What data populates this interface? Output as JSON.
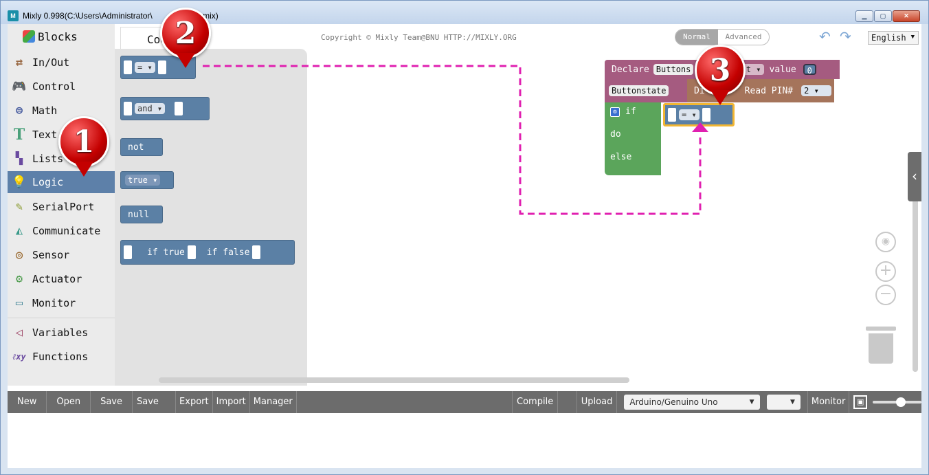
{
  "window": {
    "title": "Mixly 0.998(C:\\Users\\Administrator\\",
    "title_suffix": "sson3.mix)"
  },
  "sidebar": {
    "header": "Blocks",
    "categories": [
      {
        "label": "In/Out",
        "icon": "arrows-icon",
        "color": "#9a6a45"
      },
      {
        "label": "Control",
        "icon": "gamepad-icon",
        "color": "#4a8a4a"
      },
      {
        "label": "Math",
        "icon": "math-icon",
        "color": "#4a5ea0"
      },
      {
        "label": "Text",
        "icon": "text-icon",
        "color": "#4aa07a"
      },
      {
        "label": "Lists",
        "icon": "lists-icon",
        "color": "#6a4aa0"
      },
      {
        "label": "Logic",
        "icon": "bulb-icon",
        "color": "#ffffff"
      },
      {
        "label": "SerialPort",
        "icon": "pen-icon",
        "color": "#8a9a30"
      },
      {
        "label": "Communicate",
        "icon": "signal-icon",
        "color": "#3a9a8a"
      },
      {
        "label": "Sensor",
        "icon": "sensor-icon",
        "color": "#9a6a30"
      },
      {
        "label": "Actuator",
        "icon": "actuator-icon",
        "color": "#4a9a4a"
      },
      {
        "label": "Monitor",
        "icon": "monitor-icon",
        "color": "#4a8a9a"
      },
      {
        "label": "Variables",
        "icon": "variables-icon",
        "color": "#a04a6a"
      },
      {
        "label": "Functions",
        "icon": "functions-icon",
        "color": "#6a4aa0"
      }
    ]
  },
  "topbar": {
    "code_tab": "Cod",
    "copyright": "Copyright © Mixly Team@BNU HTTP://MIXLY.ORG",
    "mode_normal": "Normal",
    "mode_advanced": "Advanced",
    "language": "English"
  },
  "flyout": {
    "compare_op": "=",
    "and_op": "and",
    "not_label": "not",
    "true_label": "true",
    "null_label": "null",
    "ternary_true": "if true",
    "ternary_false": "if false"
  },
  "workspace": {
    "declare_label": "Declare",
    "declare_var": "Buttons",
    "declare_type": "int",
    "declare_value_label": "value",
    "declare_value": "0",
    "assign_var": "Buttonstate",
    "read_label_left": "Di",
    "read_label_right": "Read PIN#",
    "read_pin": "2",
    "if_label": "if",
    "do_label": "do",
    "else_label": "else",
    "compare_op": "="
  },
  "markers": [
    "1",
    "2",
    "3"
  ],
  "bottombar": {
    "buttons": [
      "New",
      "Open",
      "Save",
      "Save as",
      "Export",
      "Import",
      "Manager"
    ],
    "compile": "Compile",
    "upload": "Upload",
    "board": "Arduino/Genuino Uno",
    "port": "",
    "monitor": "Monitor"
  },
  "colors": {
    "logic_block": "#5b80a5",
    "variables_block": "#a55b80",
    "io_block": "#a5745b",
    "control_block": "#5ba55b",
    "highlight": "#f2b632",
    "annotation": "#e020b0"
  }
}
